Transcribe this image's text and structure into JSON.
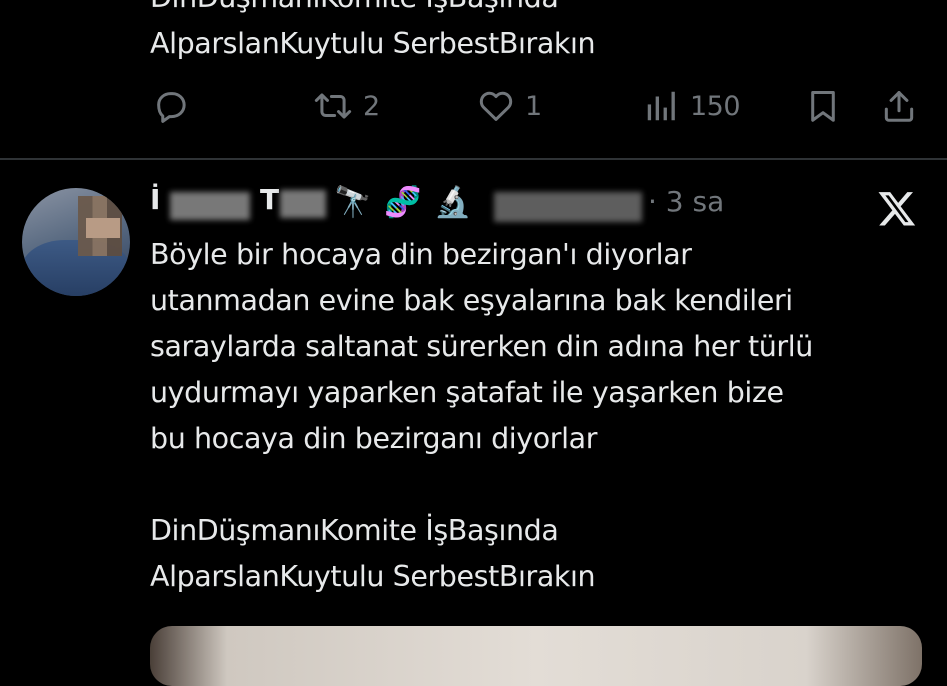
{
  "previous_tweet": {
    "line1": "DinDüşmanıKomite İşBaşında",
    "line2": "AlparslanKuytulu SerbestBırakın",
    "actions": {
      "reply_count": "",
      "retweet_count": "2",
      "like_count": "1",
      "views_count": "150"
    }
  },
  "tweet": {
    "author_initial": "İ",
    "author_mid": "T",
    "emojis": [
      "🔭",
      "🧬",
      "🔬"
    ],
    "time": "· 3 sa",
    "body": "Böyle bir hocaya din bezirgan'ı diyorlar\nutanmadan evine bak eşyalarına bak kendileri\nsaraylarda saltanat sürerken din adına her türlü\nuydurmayı yaparken şatafat ile yaşarken bize\nbu hocaya din bezirganı diyorlar\n\nDinDüşmanıKomite İşBaşında\nAlparslanKuytulu SerbestBırakın"
  },
  "icons": {
    "reply": "reply-icon",
    "retweet": "retweet-icon",
    "like": "heart-icon",
    "views": "views-icon",
    "bookmark": "bookmark-icon",
    "share": "share-icon",
    "logo": "x-logo-icon"
  },
  "colors": {
    "background": "#000000",
    "text": "#e7e9ea",
    "secondary": "#71767b",
    "divider": "#2f3336"
  }
}
